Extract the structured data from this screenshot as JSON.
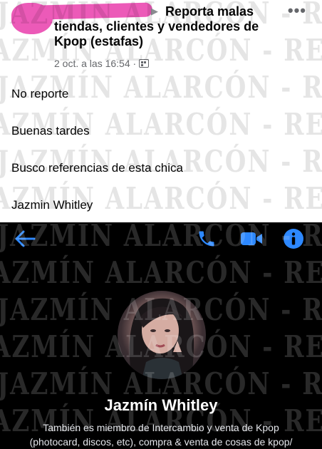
{
  "post": {
    "group_name": "Reporta malas tiendas, clientes y vendedores de Kpop (estafas)",
    "timestamp": "2 oct. a las 16:54 ·",
    "more_icon": "more-horizontal-icon",
    "audience_icon": "group-icon",
    "lines": [
      "No reporte",
      "Buenas tardes",
      "Busco referencias de esta chica",
      "Jazmin Whitley"
    ]
  },
  "watermark": {
    "text": "JAZMÍN ALARCÓN - REFERENCIAS"
  },
  "messenger": {
    "icons": {
      "back": "back-arrow-icon",
      "call": "phone-icon",
      "video": "video-camera-icon",
      "info": "info-icon"
    },
    "accent_color": "#2d88ff",
    "profile_name": "Jazmín Whitley",
    "bio_line1": "También es miembro de Intercambio y venta de Kpop",
    "bio_line2": "(photocard, discos, etc), compra & venta de cosas de kpop/"
  },
  "colors": {
    "redaction": "#ec5ab8",
    "post_background": "#ffffff",
    "messenger_background": "#000000"
  }
}
